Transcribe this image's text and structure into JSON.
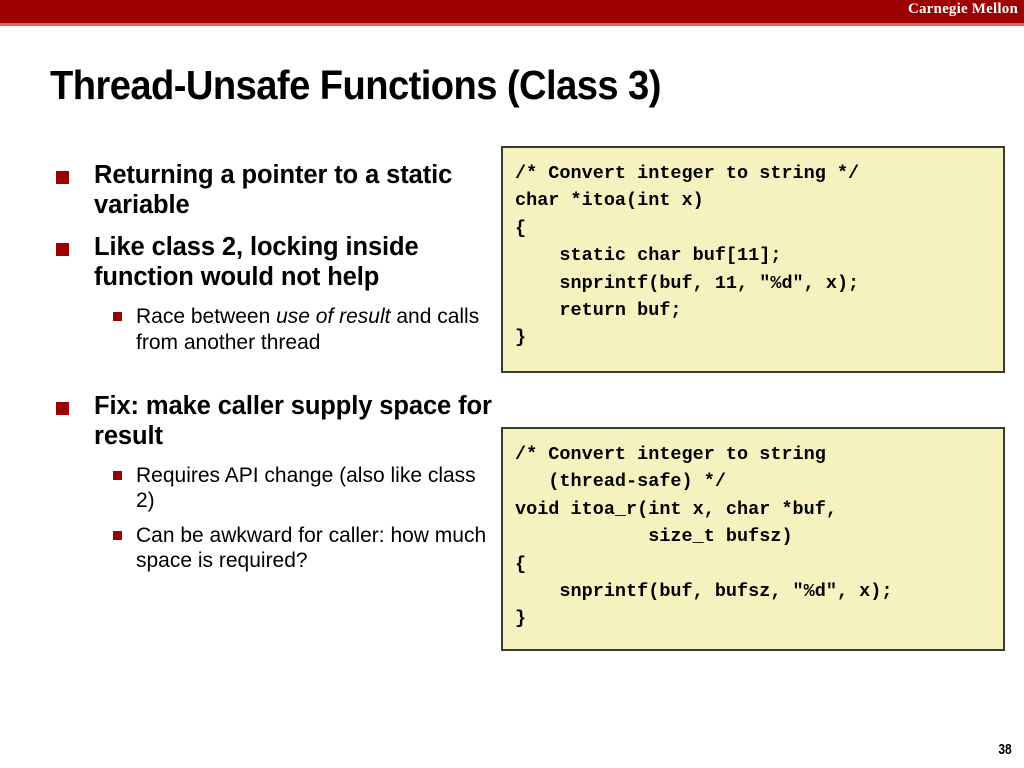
{
  "header": {
    "brand": "Carnegie Mellon",
    "band_color": "#9c0000",
    "underline_color": "#d86a63"
  },
  "title": "Thread-Unsafe Functions (Class 3)",
  "bullets": [
    {
      "level": 1,
      "text": "Returning a pointer  to a static variable"
    },
    {
      "level": 1,
      "text": "Like class 2, locking inside function would not help"
    },
    {
      "level": 2,
      "text_before": "Race between ",
      "text_italic": "use of result",
      "text_after": " and calls from another thread"
    },
    {
      "level": 1,
      "text": "Fix: make caller supply space for result"
    },
    {
      "level": 2,
      "text": "Requires API change (also like class 2)"
    },
    {
      "level": 2,
      "text": "Can be awkward for caller: how much space is required?"
    }
  ],
  "code_blocks": [
    {
      "name": "itoa-unsafe",
      "code": "/* Convert integer to string */\nchar *itoa(int x)\n{\n    static char buf[11];\n    snprintf(buf, 11, \"%d\", x);\n    return buf;\n}",
      "background": "#f5f2c0",
      "border_color": "#3a3a2e"
    },
    {
      "name": "itoa-r-threadsafe",
      "code": "/* Convert integer to string\n   (thread-safe) */\nvoid itoa_r(int x, char *buf,\n            size_t bufsz)\n{\n    snprintf(buf, bufsz, \"%d\", x);\n}",
      "background": "#f5f2c0",
      "border_color": "#3a3a2e"
    }
  ],
  "page_number": "38",
  "bullet_marker_color": "#9c0000"
}
